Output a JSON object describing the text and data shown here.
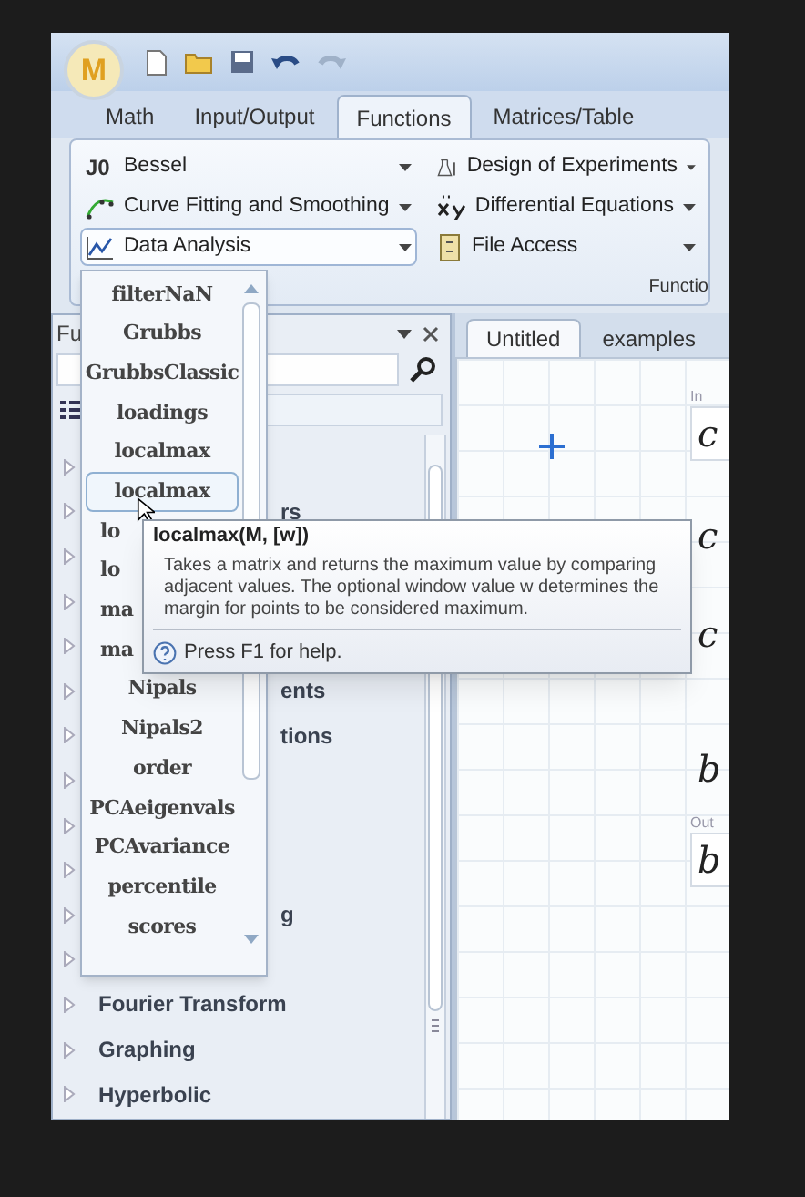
{
  "app_button": {
    "text": "M"
  },
  "ribbon_tabs": [
    {
      "label": "Math",
      "selected": false
    },
    {
      "label": "Input/Output",
      "selected": false
    },
    {
      "label": "Functions",
      "selected": true
    },
    {
      "label": "Matrices/Table",
      "selected": false
    }
  ],
  "ribbon": {
    "columns": [
      [
        {
          "label": "Bessel",
          "icon_text": "J0",
          "selected": false
        },
        {
          "label": "Curve Fitting and Smoothing",
          "selected": false
        },
        {
          "label": "Data Analysis",
          "selected": true
        }
      ],
      [
        {
          "label": "Design of Experiments",
          "selected": false
        },
        {
          "label": "Differential Equations",
          "selected": false
        },
        {
          "label": "File Access",
          "selected": false
        }
      ]
    ],
    "group_label": "Functio"
  },
  "panel": {
    "title": "Fu",
    "tree": [
      {
        "expanded": false
      },
      {
        "label": "rs",
        "covered": true,
        "expanded": false
      },
      {
        "expanded": false
      },
      {
        "expanded": false
      },
      {
        "expanded": false
      },
      {
        "label": "ents",
        "covered": true,
        "expanded": false
      },
      {
        "label": "tions",
        "covered": true,
        "expanded": false
      },
      {
        "expanded": false
      },
      {
        "expanded": false
      },
      {
        "expanded": false
      },
      {
        "label": "g",
        "covered": true,
        "expanded": false
      },
      {
        "expanded": false
      },
      {
        "label": "Fourier Transform",
        "expanded": false
      },
      {
        "label": "Graphing",
        "expanded": false
      },
      {
        "label": "Hyperbolic",
        "expanded": false
      }
    ]
  },
  "dropdown": {
    "items": [
      {
        "label": "filterNaN",
        "selected": false
      },
      {
        "label": "Grubbs",
        "selected": false
      },
      {
        "label": "GrubbsClassic",
        "selected": false
      },
      {
        "label": "loadings",
        "selected": false
      },
      {
        "label": "localmax",
        "selected": false
      },
      {
        "label": "localmax",
        "selected": true
      },
      {
        "label": "lo",
        "selected": false,
        "covered": true
      },
      {
        "label": "lo",
        "selected": false,
        "covered": true
      },
      {
        "label": "ma",
        "selected": false,
        "covered": true
      },
      {
        "label": "ma",
        "selected": false,
        "covered": true
      },
      {
        "label": "Nipals",
        "selected": false
      },
      {
        "label": "Nipals2",
        "selected": false
      },
      {
        "label": "order",
        "selected": false
      },
      {
        "label": "PCAeigenvals",
        "selected": false
      },
      {
        "label": "PCAvariance",
        "selected": false
      },
      {
        "label": "percentile",
        "selected": false
      },
      {
        "label": "scores",
        "selected": false
      }
    ]
  },
  "tooltip": {
    "title": "localmax(M, [w])",
    "body": "Takes a matrix and returns the maximum value by comparing adjacent values. The optional window value w determines the margin for points to be considered maximum.",
    "help": "Press F1 for help."
  },
  "doc_tabs": [
    {
      "label": "Untitled",
      "selected": true
    },
    {
      "label": "examples",
      "selected": false
    }
  ],
  "worksheet": {
    "regions": [
      {
        "kind": "boxed",
        "label": "In",
        "text": "c"
      },
      {
        "kind": "plain",
        "text": "c"
      },
      {
        "kind": "plain",
        "text": "c"
      },
      {
        "kind": "plain",
        "text": "b"
      },
      {
        "kind": "boxed",
        "label": "Out",
        "text": "b"
      }
    ]
  }
}
